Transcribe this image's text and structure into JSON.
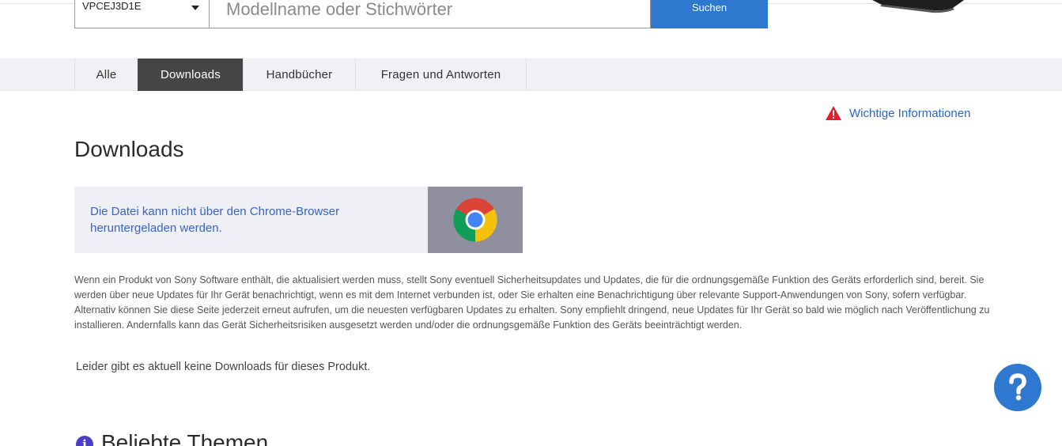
{
  "search": {
    "model_value": "VPCEJ3D1E",
    "placeholder": "Modellname oder Stichwörter",
    "button_label": "Suchen"
  },
  "tabs": [
    {
      "label": "Alle",
      "active": false
    },
    {
      "label": "Downloads",
      "active": true
    },
    {
      "label": "Handbücher",
      "active": false
    },
    {
      "label": "Fragen und Antworten",
      "active": false
    }
  ],
  "important_info": {
    "label": "Wichtige Informationen",
    "icon": "warning-triangle-icon"
  },
  "page_title": "Downloads",
  "chrome_notice": {
    "message": "Die Datei kann nicht über den Chrome-Browser heruntergeladen werden.",
    "icon": "chrome-logo-icon"
  },
  "disclaimer": "Wenn ein Produkt von Sony Software enthält, die aktualisiert werden muss, stellt Sony eventuell Sicherheitsupdates und Updates, die für die ordnungsgemäße Funktion des Geräts erforderlich sind, bereit. Sie werden über neue Updates für Ihr Gerät benachrichtigt, wenn es mit dem Internet verbunden ist, oder Sie erhalten eine Benachrichtigung über relevante Support-Anwendungen von Sony, sofern verfügbar. Alternativ können Sie diese Seite jederzeit erneut aufrufen, um die neuesten verfügbaren Updates zu erhalten. Sony empfiehlt dringend, neue Updates für Ihr Gerät so bald wie möglich nach Veröffentlichung zu installieren. Andernfalls kann das Gerät Sicherheitsrisiken ausgesetzt werden und/oder die ordnungsgemäße Funktion des Geräts beeinträchtigt werden.",
  "no_downloads": "Leider gibt es aktuell keine Downloads für dieses Produkt.",
  "help_button": {
    "label": "?"
  },
  "popular_topics": {
    "icon_label": "i",
    "heading": "Beliebte Themen"
  },
  "colors": {
    "accent": "#2f78cf",
    "link": "#2a64c9",
    "active_tab": "#454545",
    "warning": "#e0202a"
  }
}
